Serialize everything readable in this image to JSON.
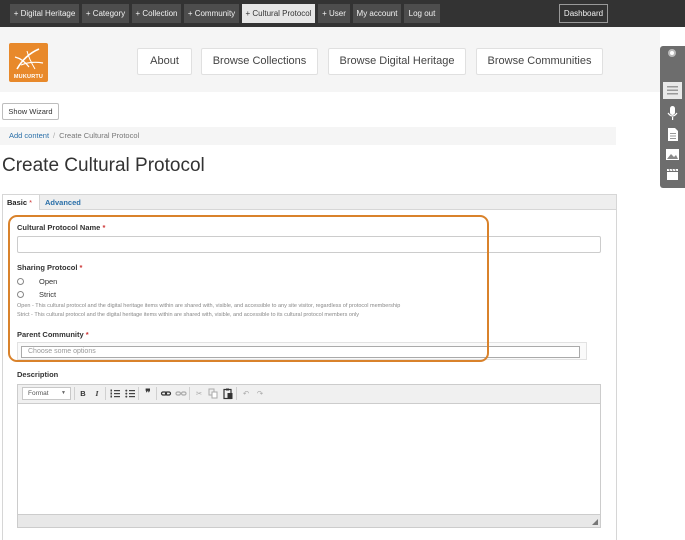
{
  "topbar": {
    "items": [
      "+ Digital Heritage",
      "+ Category",
      "+ Collection",
      "+ Community",
      "+ Cultural Protocol",
      "+ User",
      "My account",
      "Log out"
    ],
    "dashboard": "Dashboard"
  },
  "header": {
    "logo_text": "MUKURTU",
    "nav": [
      "About",
      "Browse Collections",
      "Browse Digital Heritage",
      "Browse Communities"
    ]
  },
  "wizard_button": "Show Wizard",
  "breadcrumb": {
    "link": "Add content",
    "separator": "/",
    "current": "Create Cultural Protocol"
  },
  "page_title": "Create Cultural Protocol",
  "tabs": {
    "basic": "Basic",
    "basic_marker": "*",
    "advanced": "Advanced"
  },
  "form": {
    "name_label": "Cultural Protocol Name",
    "sharing_label": "Sharing Protocol",
    "required_marker": "*",
    "options": [
      "Open",
      "Strict"
    ],
    "help_open": "Open - This cultural protocol and the digital heritage items within are shared with, visible, and accessible to any site visitor, regardless of protocol membership",
    "help_strict": "Strict - This cultural protocol and the digital heritage items within are shared with, visible, and accessible to its cultural protocol members only",
    "parent_label": "Parent Community",
    "parent_placeholder": "Choose some options",
    "description_label": "Description"
  },
  "editor": {
    "format_label": "Format",
    "tools": [
      "bold-icon",
      "italic-icon",
      "numbered-list-icon",
      "bullet-list-icon",
      "blockquote-icon",
      "link-icon",
      "unlink-icon",
      "cut-icon",
      "copy-icon",
      "paste-icon",
      "undo-icon",
      "redo-icon"
    ]
  },
  "colors": {
    "accent": "#d9822b",
    "link": "#2a6fa8",
    "topbar": "#333333"
  }
}
